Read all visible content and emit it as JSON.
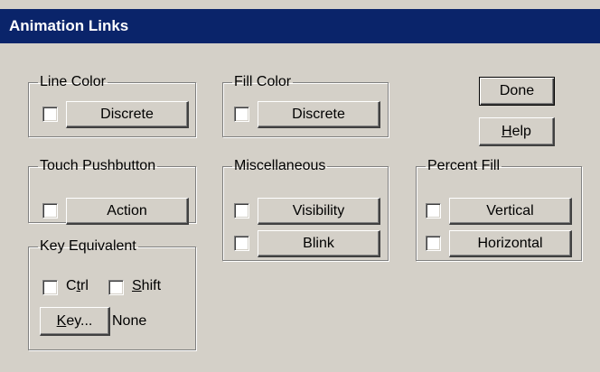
{
  "window": {
    "title": "Animation Links"
  },
  "groups": {
    "line_color": {
      "legend": "Line Color",
      "button": "Discrete"
    },
    "fill_color": {
      "legend": "Fill Color",
      "button": "Discrete"
    },
    "touch_pushbutton": {
      "legend": "Touch Pushbutton",
      "button": "Action"
    },
    "miscellaneous": {
      "legend": "Miscellaneous",
      "visibility": "Visibility",
      "blink": "Blink"
    },
    "percent_fill": {
      "legend": "Percent Fill",
      "vertical": "Vertical",
      "horizontal": "Horizontal"
    },
    "key_equivalent": {
      "legend": "Key Equivalent",
      "ctrl_pre": "C",
      "ctrl_ul": "t",
      "ctrl_post": "rl",
      "shift_ul": "S",
      "shift_post": "hift",
      "key_ul": "K",
      "key_post": "ey...",
      "key_value": "None"
    }
  },
  "buttons": {
    "done": "Done",
    "help_ul": "H",
    "help_post": "elp"
  },
  "colors": {
    "titlebar": "#0a246a",
    "face": "#d4d0c8"
  }
}
